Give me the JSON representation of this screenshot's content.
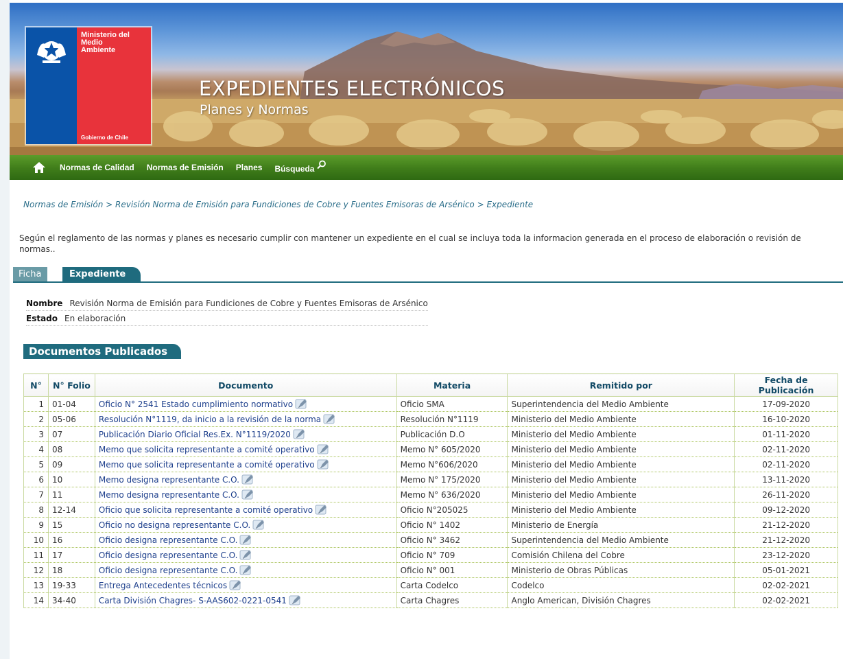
{
  "logo": {
    "ministry": [
      "Ministerio del",
      "Medio",
      "Ambiente"
    ],
    "government": "Gobierno de Chile"
  },
  "header": {
    "title": "EXPEDIENTES ELECTRÓNICOS",
    "subtitle": "Planes y Normas"
  },
  "nav": {
    "home_icon": "home-icon",
    "items": [
      "Normas de Calidad",
      "Normas de Emisión",
      "Planes",
      "Búsqueda"
    ],
    "search_icon": "search-icon"
  },
  "breadcrumb": {
    "items": [
      "Normas de Emisión",
      "Revisión Norma de Emisión para Fundiciones de Cobre y Fuentes Emisoras de Arsénico",
      "Expediente"
    ],
    "separator": " > "
  },
  "intro": "Según el reglamento de las normas y planes es necesario cumplir con mantener un expediente en el cual se incluya toda la informacion generada en el proceso de elaboración o revisión de normas..",
  "tabs": [
    "Ficha",
    "Expediente"
  ],
  "info": {
    "nombre_label": "Nombre",
    "nombre": "Revisión Norma de Emisión para Fundiciones de Cobre y Fuentes Emisoras de Arsénico",
    "estado_label": "Estado",
    "estado": "En elaboración"
  },
  "section_title": "Documentos Publicados",
  "table": {
    "headers": [
      "N°",
      "N° Folio",
      "Documento",
      "Materia",
      "Remitido por",
      "Fecha de Publicación"
    ],
    "rows": [
      [
        "1",
        "01-04",
        "Oficio N° 2541 Estado cumplimiento normativo",
        "Oficio SMA",
        "Superintendencia del Medio Ambiente",
        "17-09-2020"
      ],
      [
        "2",
        "05-06",
        "Resolución N°1119, da inicio a la revisión de la norma",
        "Resolución N°1119",
        "Ministerio del Medio Ambiente",
        "16-10-2020"
      ],
      [
        "3",
        "07",
        "Publicación Diario Oficial Res.Ex. N°1119/2020",
        "Publicación D.O",
        "Ministerio del Medio Ambiente",
        "01-11-2020"
      ],
      [
        "4",
        "08",
        "Memo que solicita representante a comité operativo",
        "Memo N° 605/2020",
        "Ministerio del Medio Ambiente",
        "02-11-2020"
      ],
      [
        "5",
        "09",
        "Memo que solicita representante a comité operativo",
        "Memo N°606/2020",
        "Ministerio del Medio Ambiente",
        "02-11-2020"
      ],
      [
        "6",
        "10",
        "Memo designa representante C.O.",
        "Memo N° 175/2020",
        "Ministerio del Medio Ambiente",
        "13-11-2020"
      ],
      [
        "7",
        "11",
        "Memo designa representante C.O.",
        "Memo N° 636/2020",
        "Ministerio del Medio Ambiente",
        "26-11-2020"
      ],
      [
        "8",
        "12-14",
        "Oficio que solicita representante a comité operativo",
        "Oficio N°205025",
        "Ministerio del Medio Ambiente",
        "09-12-2020"
      ],
      [
        "9",
        "15",
        "Oficio no designa representante C.O.",
        "Oficio N° 1402",
        "Ministerio de Energía",
        "21-12-2020"
      ],
      [
        "10",
        "16",
        "Oficio designa representante C.O.",
        "Oficio N° 3462",
        "Superintendencia del Medio Ambiente",
        "21-12-2020"
      ],
      [
        "11",
        "17",
        "Oficio designa representante C.O.",
        "Oficio N° 709",
        "Comisión Chilena del Cobre",
        "23-12-2020"
      ],
      [
        "12",
        "18",
        "Oficio designa representante C.O.",
        "Oficio N° 001",
        "Ministerio de Obras Públicas",
        "05-01-2021"
      ],
      [
        "13",
        "19-33",
        "Entrega Antecedentes técnicos",
        "Carta Codelco",
        "Codelco",
        "02-02-2021"
      ],
      [
        "14",
        "34-40",
        "Carta División Chagres- S-AAS602-0221-0541",
        "Carta Chagres",
        "Anglo American, División Chagres",
        "02-02-2021"
      ]
    ],
    "edit_icon": "pencil-icon"
  }
}
